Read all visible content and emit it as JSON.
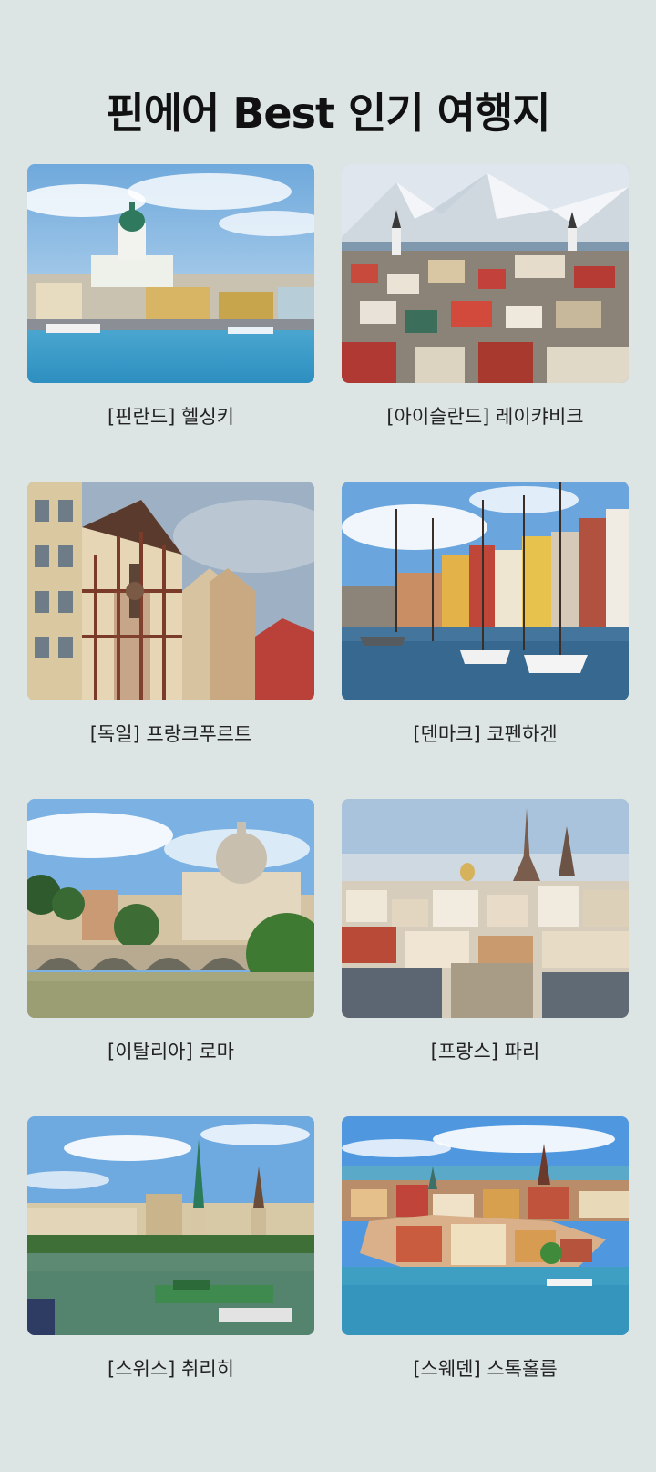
{
  "page": {
    "title": "핀에어 Best 인기 여행지",
    "background": "#dde5e4"
  },
  "destinations": [
    {
      "label": "[핀란드] 헬싱키",
      "scene": "helsinki-harbor-cathedral"
    },
    {
      "label": "[아이슬란드] 레이캬비크",
      "scene": "reykjavik-snowy-mountains"
    },
    {
      "label": "[독일] 프랑크푸르트",
      "scene": "frankfurt-half-timbered-houses"
    },
    {
      "label": "[덴마크] 코펜하겐",
      "scene": "copenhagen-nyhavn-sailboats"
    },
    {
      "label": "[이탈리아] 로마",
      "scene": "rome-st-peters-bridge"
    },
    {
      "label": "[프랑스] 파리",
      "scene": "paris-rooftops-eiffel-tower"
    },
    {
      "label": "[스위스] 취리히",
      "scene": "zurich-lake-church-spires"
    },
    {
      "label": "[스웨덴] 스톡홀름",
      "scene": "stockholm-old-town-aerial"
    }
  ]
}
